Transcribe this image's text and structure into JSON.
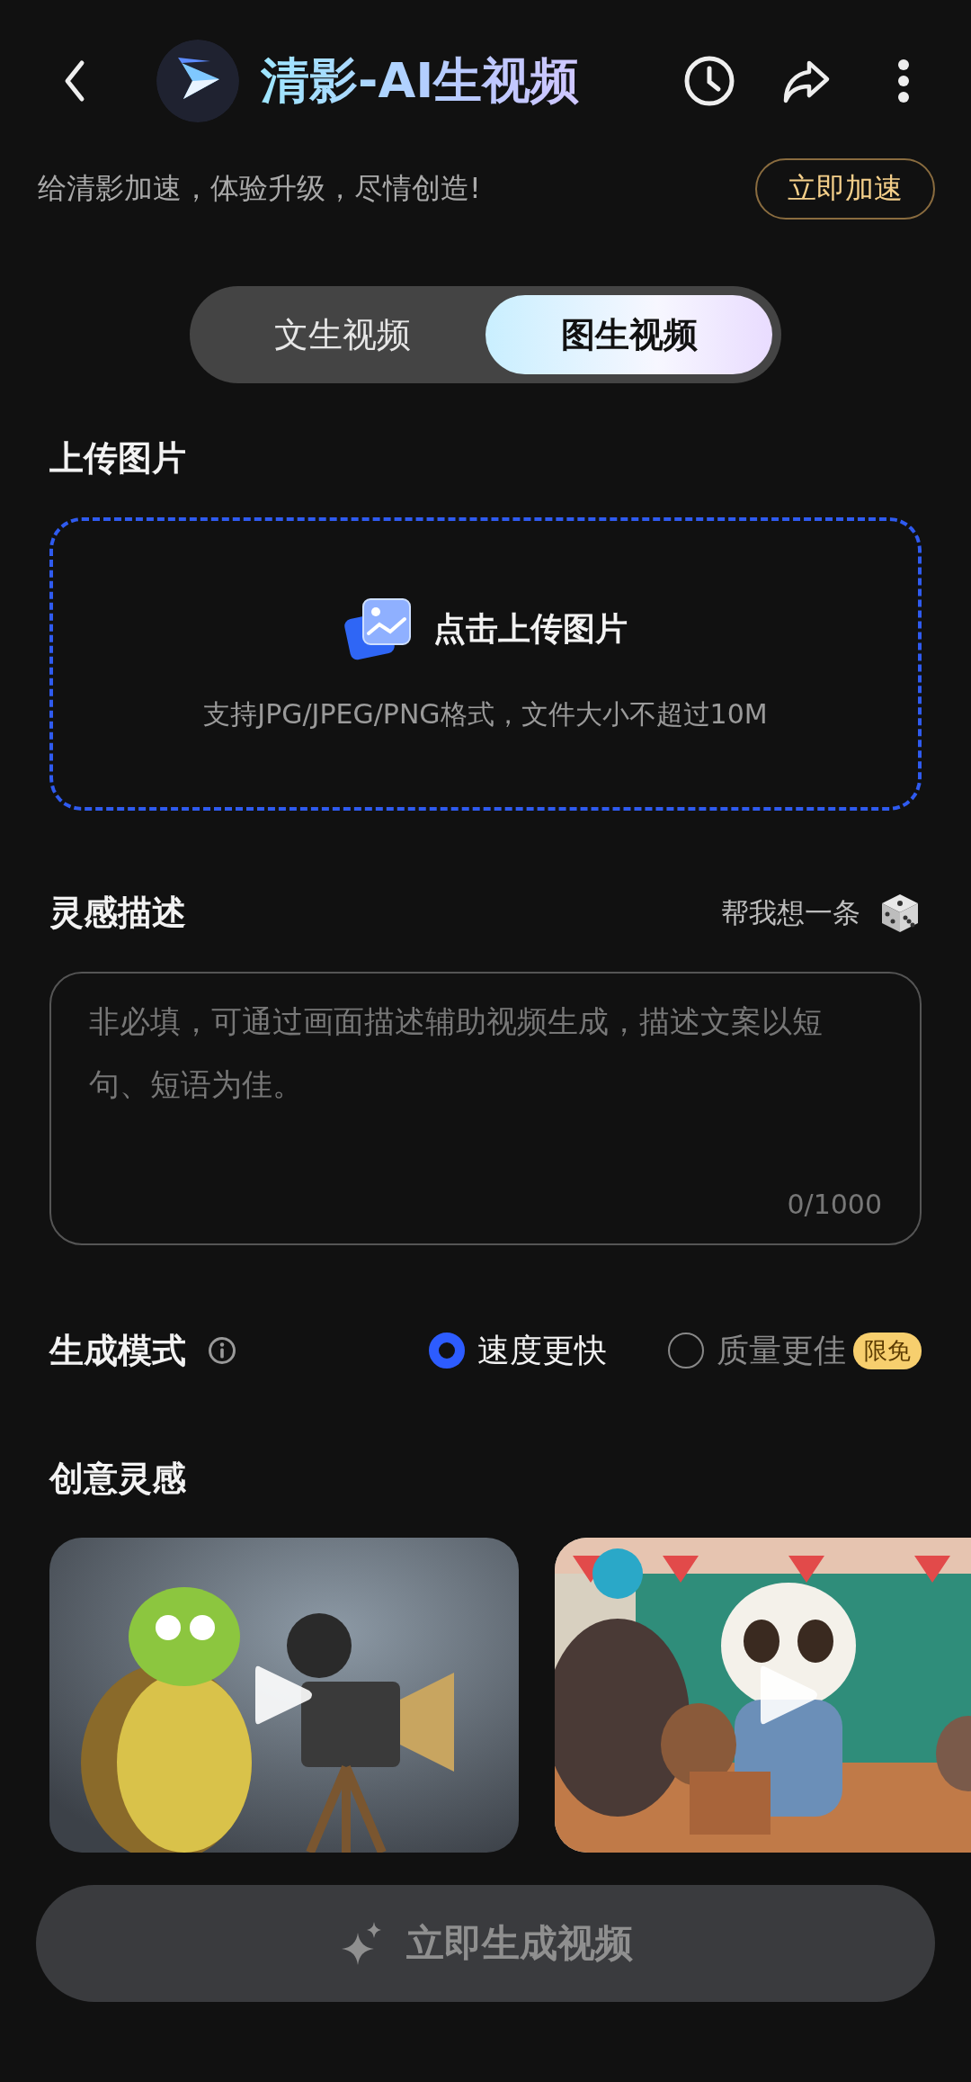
{
  "header": {
    "title": "清影-AI生视频"
  },
  "promo": {
    "text": "给清影加速，体验升级，尽情创造!",
    "button": "立即加速"
  },
  "tabs": [
    {
      "label": "文生视频",
      "selected": false
    },
    {
      "label": "图生视频",
      "selected": true
    }
  ],
  "upload": {
    "heading": "上传图片",
    "action": "点击上传图片",
    "hint": "支持JPG/JPEG/PNG格式，文件大小不超过10M"
  },
  "prompt": {
    "heading": "灵感描述",
    "helper": "帮我想一条",
    "placeholder": "非必填，可通过画面描述辅助视频生成，描述文案以短句、短语为佳。",
    "counter": "0/1000"
  },
  "mode": {
    "heading": "生成模式",
    "options": [
      {
        "label": "速度更快",
        "selected": true
      },
      {
        "label": "质量更佳",
        "selected": false,
        "badge": "限免"
      }
    ]
  },
  "inspiration": {
    "heading": "创意灵感"
  },
  "generate_button": {
    "label": "立即生成视频",
    "disabled": true
  }
}
